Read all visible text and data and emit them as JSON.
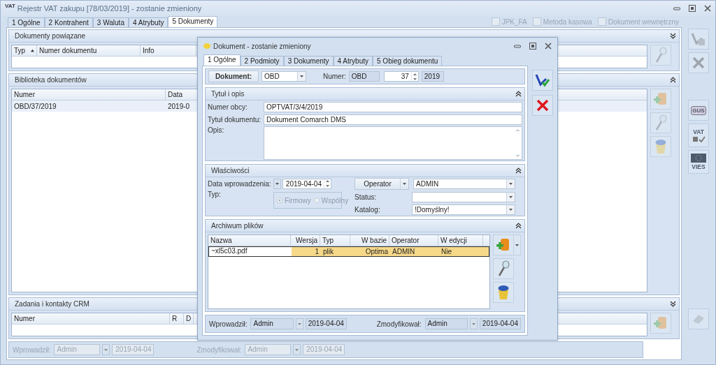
{
  "window": {
    "icon_text": "VAT",
    "title": "Rejestr VAT zakupu [78/03/2019] - zostanie zmieniony"
  },
  "tabs": [
    {
      "label": "1 Ogólne",
      "selected": false
    },
    {
      "label": "2 Kontrahent",
      "selected": false
    },
    {
      "label": "3 Waluta",
      "selected": false
    },
    {
      "label": "4 Atrybuty",
      "selected": false
    },
    {
      "label": "5 Dokumenty",
      "selected": true
    }
  ],
  "flags": [
    {
      "label": "JPK_FA",
      "checked": false,
      "disabled": true
    },
    {
      "label": "Metoda kasowa",
      "checked": false,
      "disabled": true
    },
    {
      "label": "Dokument wewnętrzny",
      "checked": false,
      "disabled": true
    }
  ],
  "sections": [
    {
      "title": "Dokumenty powiązane",
      "expanded": false,
      "columns": [
        {
          "label": "Typ",
          "sorted": true
        },
        {
          "label": "Numer dokumentu",
          "sorted": false
        },
        {
          "label": "Info",
          "sorted": false
        }
      ],
      "tools": [
        {
          "kind": "preview"
        }
      ]
    },
    {
      "title": "Biblioteka dokumentów",
      "expanded": true,
      "columns": [
        {
          "label": "Numer"
        },
        {
          "label": "Data"
        }
      ],
      "rows": [
        {
          "cells": [
            "OBD/37/2019",
            "2019-0"
          ],
          "selected": true
        }
      ],
      "tools": [
        {
          "kind": "add"
        },
        {
          "kind": "preview"
        },
        {
          "kind": "delete"
        }
      ]
    },
    {
      "title": "Zadania i kontakty CRM",
      "expanded": false,
      "columns": [
        {
          "label": "Numer"
        },
        {
          "label": "R"
        },
        {
          "label": "D"
        }
      ],
      "tools": [
        {
          "kind": "add"
        }
      ]
    }
  ],
  "right_tools": [
    {
      "kind": "gus",
      "label": "GUS"
    },
    {
      "kind": "vat",
      "label": "VAT"
    },
    {
      "kind": "vies",
      "label": "VIES"
    }
  ],
  "footer": {
    "disabled": true,
    "created_label": "Wprowadził:",
    "created_by": "Admin",
    "created_date": "2019-04-04",
    "modified_label": "Zmodyfikował:",
    "modified_by": "Admin",
    "modified_date": "2019-04-04"
  },
  "dialog": {
    "title": "Dokument - zostanie zmieniony",
    "tabs": [
      {
        "label": "1 Ogólne",
        "selected": true
      },
      {
        "label": "2 Podmioty",
        "selected": false
      },
      {
        "label": "3 Dokumenty",
        "selected": false
      },
      {
        "label": "4 Atrybuty",
        "selected": false
      },
      {
        "label": "5 Obieg dokumentu",
        "selected": false
      }
    ],
    "header": {
      "doc_button": "Dokument:",
      "doc_type": "OBD",
      "number_label": "Numer:",
      "number_prefix": "OBD",
      "number": "37",
      "number_year": "2019"
    },
    "title_section": {
      "title": "Tytuł i opis",
      "expanded": true,
      "fields": [
        {
          "label": "Numer obcy:",
          "value": "OPTVAT/3/4/2019"
        },
        {
          "label": "Tytuł dokumentu:",
          "value": "Dokument Comarch DMS"
        }
      ],
      "description_label": "Opis:"
    },
    "properties": {
      "title": "Właściwości",
      "expanded": true,
      "date_label": "Data wprowadzenia:",
      "date": "2019-04-04",
      "type_label": "Typ:",
      "type_disabled": true,
      "type_options": [
        {
          "label": "Firmowy",
          "selected": true
        },
        {
          "label": "Wspólny",
          "selected": false
        }
      ],
      "operator_button": "Operator",
      "operator": "ADMIN",
      "status_label": "Status:",
      "catalog_label": "Katalog:",
      "catalog": "!Domyślny!"
    },
    "archive": {
      "title": "Archiwum plików",
      "expanded": true,
      "columns": [
        "Nazwa",
        "Wersja",
        "Typ",
        "W bazie",
        "Operator",
        "W edycji"
      ],
      "rows": [
        {
          "cells": [
            "~xl5c03.pdf",
            "1",
            "plik",
            "Optima",
            "ADMIN",
            "Nie"
          ],
          "selected": true
        }
      ]
    },
    "footer": {
      "disabled": false,
      "created_label": "Wprowadził:",
      "created_by": "Admin",
      "created_date": "2019-04-04",
      "modified_label": "Zmodyfikował:",
      "modified_by": "Admin",
      "modified_date": "2019-04-04"
    }
  }
}
